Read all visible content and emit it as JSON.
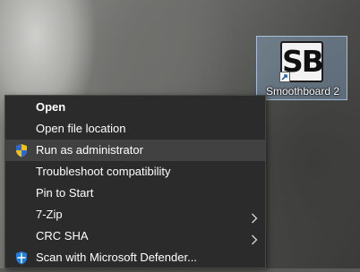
{
  "desktop": {
    "icon": {
      "logo_text": "SB",
      "label": "Smoothboard 2",
      "logo_icon": "smoothboard-logo-icon",
      "overlay_icon": "shortcut-arrow-icon"
    }
  },
  "context_menu": {
    "items": [
      {
        "label": "Open",
        "bold": true
      },
      {
        "label": "Open file location"
      },
      {
        "label": "Run as administrator",
        "icon": "uac-shield-icon",
        "highlighted": true
      },
      {
        "label": "Troubleshoot compatibility"
      },
      {
        "label": "Pin to Start"
      },
      {
        "label": "7-Zip",
        "submenu": true,
        "submenu_icon": "chevron-right-icon"
      },
      {
        "label": "CRC SHA",
        "submenu": true,
        "submenu_icon": "chevron-right-icon"
      },
      {
        "label": "Scan with Microsoft Defender...",
        "icon": "defender-shield-icon"
      }
    ]
  },
  "colors": {
    "menu_background": "#2b2b2b",
    "menu_highlight": "#414141",
    "menu_text": "#ffffff",
    "icon_selection": "#96bee6"
  }
}
